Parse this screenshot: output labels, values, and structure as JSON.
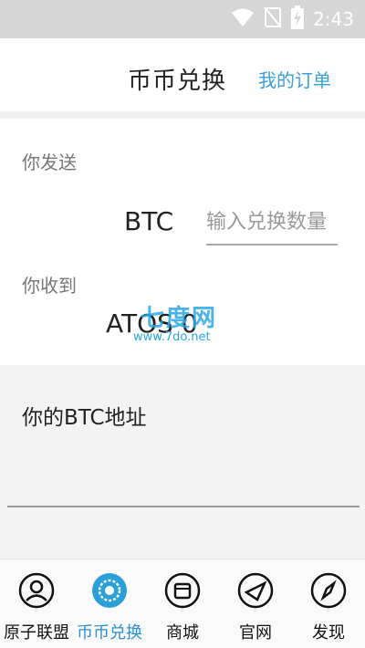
{
  "status_bar": {
    "time": "2:43",
    "icons": [
      "wifi-icon",
      "no-sim-icon",
      "battery-charging-icon"
    ]
  },
  "header": {
    "title": "币币兑换",
    "my_orders_link": "我的订单"
  },
  "send": {
    "label": "你发送",
    "currency": "BTC",
    "amount_placeholder": "输入兑换数量"
  },
  "receive": {
    "label": "你收到",
    "value": "ATOS  0"
  },
  "watermark": {
    "text_large": "七度网",
    "text_small": "www.7do.net"
  },
  "address": {
    "title": "你的BTC地址",
    "value": ""
  },
  "tabbar": {
    "tabs": [
      {
        "label": "原子联盟",
        "icon": "user-circle-icon",
        "active": false
      },
      {
        "label": "币币兑换",
        "icon": "exchange-coin-icon",
        "active": true
      },
      {
        "label": "商城",
        "icon": "shop-icon",
        "active": false
      },
      {
        "label": "官网",
        "icon": "compass-globe-icon",
        "active": false
      },
      {
        "label": "发现",
        "icon": "discover-compass-icon",
        "active": false
      }
    ]
  },
  "colors": {
    "accent": "#3aa0d8",
    "status_bar": "#d6d6d6",
    "panel": "#f3f3f3"
  }
}
